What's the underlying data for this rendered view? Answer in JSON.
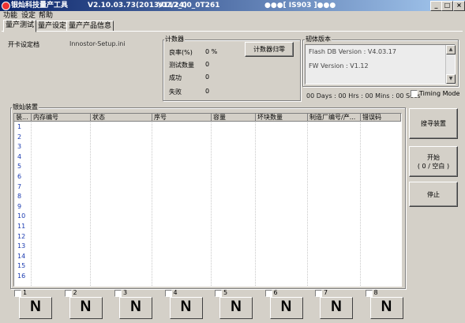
{
  "window": {
    "title_parts": [
      "银灿科技量产工具",
      "V2.10.03.73(2013/07/24)",
      "V112_00_0T261",
      "●●●[ IS903 ]●●●"
    ],
    "min_label": "_",
    "max_label": "□",
    "close_label": "×"
  },
  "menu": [
    "功能",
    "设定",
    "帮助"
  ],
  "tabs": [
    "量产测试",
    "量产设定",
    "量产产品信息"
  ],
  "card": {
    "label": "开卡设定档",
    "value": "Innostor-Setup.ini"
  },
  "counter": {
    "title": "计数器",
    "rows": [
      {
        "label": "良率(%)",
        "value": "0 %"
      },
      {
        "label": "测试数量",
        "value": "0"
      },
      {
        "label": "成功",
        "value": "0"
      },
      {
        "label": "失败",
        "value": "0"
      }
    ],
    "reset_button": "计数器归零"
  },
  "firmware": {
    "title": "韧体版本",
    "lines": [
      "Flash DB Version :  V4.03.17",
      "FW Version :  V1.12"
    ],
    "elapsed": "00 Days : 00 Hrs : 00 Mins : 00 Secs",
    "timing_mode": "Timing Mode"
  },
  "devices": {
    "title": "银灿装置",
    "columns": [
      "装...",
      "内存编号",
      "状态",
      "序号",
      "容量",
      "坏块数量",
      "制造厂编号/产...",
      "错误码"
    ],
    "rows": [
      "1",
      "2",
      "3",
      "4",
      "5",
      "6",
      "7",
      "8",
      "9",
      "10",
      "11",
      "12",
      "13",
      "14",
      "15",
      "16"
    ]
  },
  "buttons": {
    "search": "搜寻装置",
    "start_line1": "开始",
    "start_line2": "( 0 / 空白 )",
    "stop": "停止"
  },
  "slots": [
    {
      "num": "1",
      "letter": "N"
    },
    {
      "num": "2",
      "letter": "N"
    },
    {
      "num": "3",
      "letter": "N"
    },
    {
      "num": "4",
      "letter": "N"
    },
    {
      "num": "5",
      "letter": "N"
    },
    {
      "num": "6",
      "letter": "N"
    },
    {
      "num": "7",
      "letter": "N"
    },
    {
      "num": "8",
      "letter": "N"
    }
  ]
}
